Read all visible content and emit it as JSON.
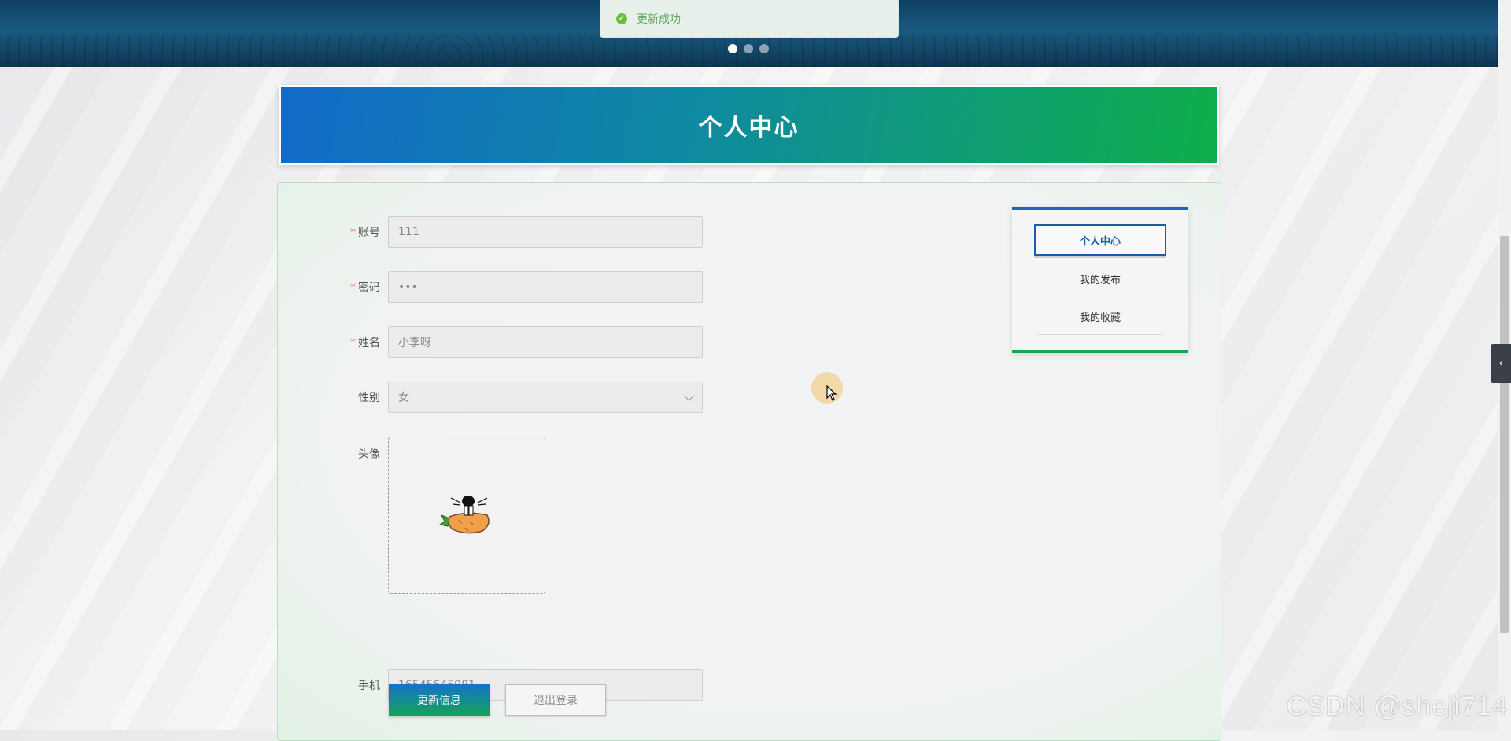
{
  "toast": {
    "message": "更新成功",
    "icon": "check-circle-icon",
    "color": "#67c23a"
  },
  "banner": {
    "slides": 3,
    "active_slide": 1
  },
  "page": {
    "title": "个人中心"
  },
  "form": {
    "fields": [
      {
        "label": "账号",
        "required": true,
        "value": "111"
      },
      {
        "label": "密码",
        "required": true,
        "value": "•••"
      },
      {
        "label": "姓名",
        "required": true,
        "value": "小李呀"
      },
      {
        "label": "性别",
        "required": false,
        "value": "女"
      }
    ],
    "avatar_label": "头像",
    "phone": {
      "label": "手机",
      "value": "16545645981"
    },
    "update_button": "更新信息",
    "logout_button": "退出登录"
  },
  "side_menu": {
    "items": [
      {
        "label": "个人中心",
        "active": true
      },
      {
        "label": "我的发布",
        "active": false
      },
      {
        "label": "我的收藏",
        "active": false
      }
    ]
  },
  "watermark": "CSDN @sheji714",
  "colors": {
    "primary_blue": "#1667c5",
    "primary_green": "#13a84e",
    "required": "#f56c6c"
  }
}
